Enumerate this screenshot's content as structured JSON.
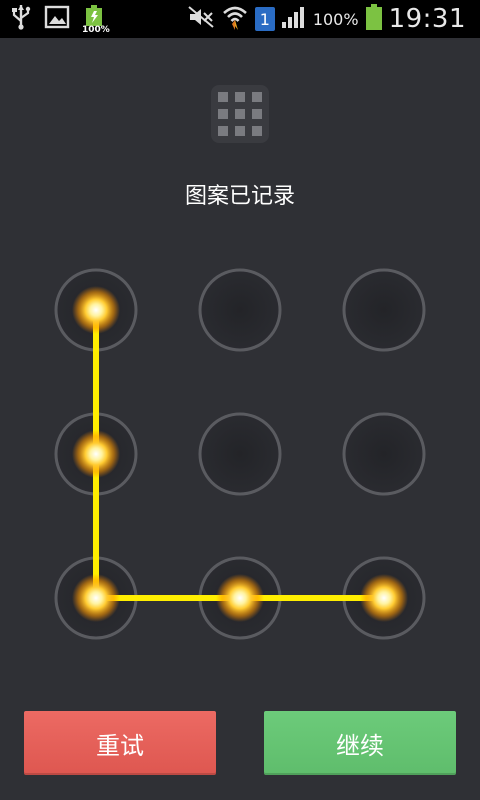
{
  "status_bar": {
    "battery_mini_label": "100%",
    "sim_label": "1",
    "battery_percent": "100%",
    "time": "19:31"
  },
  "header": {
    "title": "图案已记录"
  },
  "pattern": {
    "grid": "3x3",
    "selected_sequence": [
      1,
      4,
      7,
      8,
      9
    ],
    "colors": {
      "dot_ring": "#5a5b60",
      "dot_fill": "#27282c",
      "active_glow": "#ffcc33",
      "line": "#ffee00"
    }
  },
  "actions": {
    "retry_label": "重试",
    "continue_label": "继续"
  },
  "icons": [
    "usb-icon",
    "image-icon",
    "battery-icon",
    "mute-icon",
    "wifi-icon",
    "signal-icon",
    "pattern-grid-icon"
  ]
}
